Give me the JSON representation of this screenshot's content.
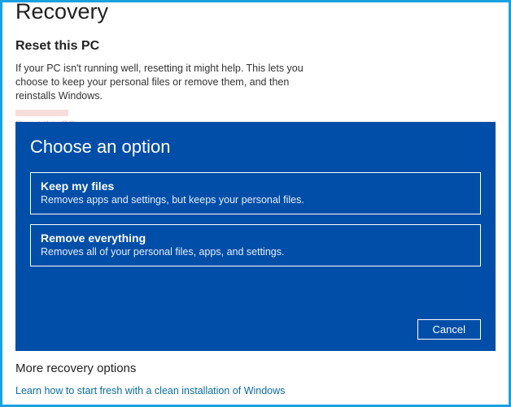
{
  "page_title": "Recovery",
  "reset_section": {
    "title": "Reset this PC",
    "description": "If your PC isn't running well, resetting it might help. This lets you choose to keep your personal files or remove them, and then reinstalls Windows.",
    "ghost_button_label": "Reset this PC"
  },
  "modal": {
    "title": "Choose an option",
    "options": [
      {
        "title": "Keep my files",
        "description": "Removes apps and settings, but keeps your personal files."
      },
      {
        "title": "Remove everything",
        "description": "Removes all of your personal files, apps, and settings."
      }
    ],
    "cancel_label": "Cancel"
  },
  "more_section": {
    "title": "More recovery options",
    "link_text": "Learn how to start fresh with a clean installation of Windows"
  }
}
